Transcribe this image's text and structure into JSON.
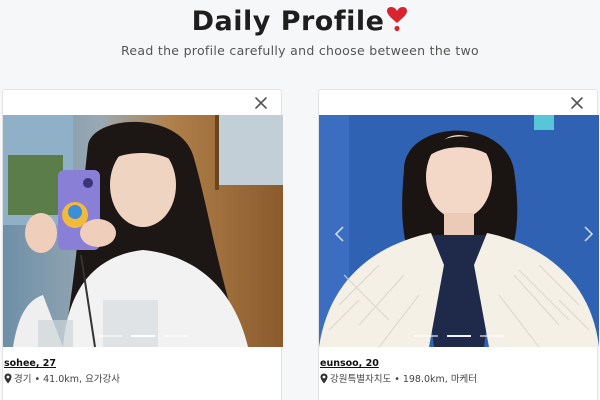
{
  "header": {
    "title": "Daily Profile",
    "heart_icon": "heart-exclamation-icon",
    "subtitle": "Read the profile carefully and choose between the two"
  },
  "colors": {
    "background": "#f6f7f8",
    "heart": "#d9242f",
    "card_border": "#e2e2e2"
  },
  "cards": [
    {
      "name": "sohee, 27",
      "location": "경기 • 41.0km, 요가강사",
      "close_icon": "close-icon",
      "location_icon": "map-pin-icon",
      "photo_count": 3,
      "active_photo": 1
    },
    {
      "name": "eunsoo, 20",
      "location": "강원특별자치도 • 198.0km, 마케터",
      "close_icon": "close-icon",
      "location_icon": "map-pin-icon",
      "prev_icon": "chevron-left-icon",
      "next_icon": "chevron-right-icon",
      "photo_count": 3,
      "active_photo": 1
    }
  ]
}
